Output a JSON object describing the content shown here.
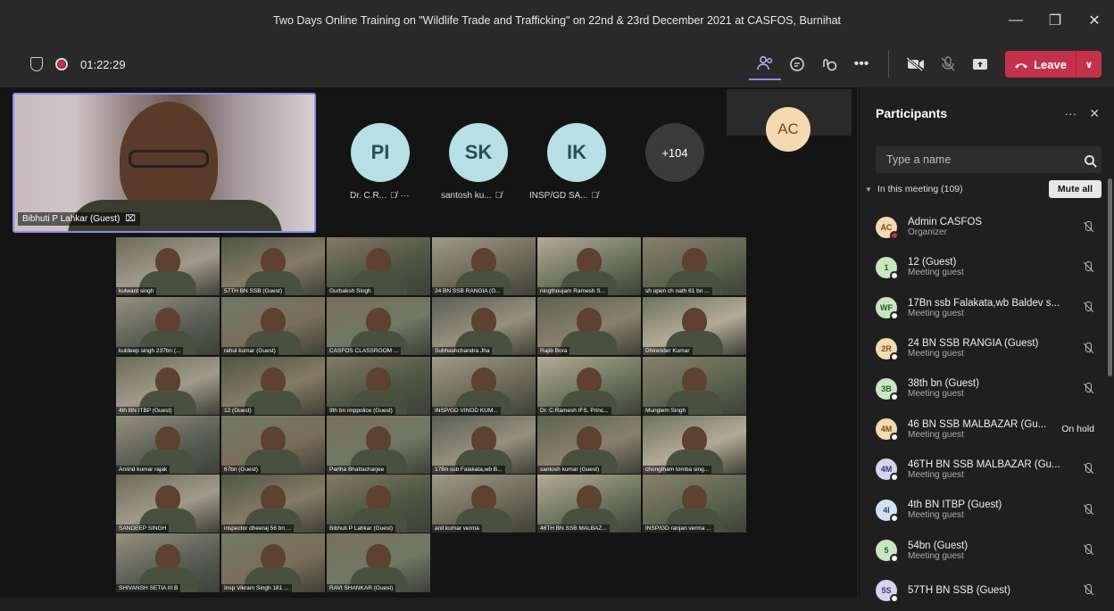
{
  "window": {
    "title": "Two Days Online Training on \"Wildlife Trade and Trafficking\" on 22nd & 23rd December 2021 at CASFOS, Burnihat",
    "controls": [
      "—",
      "❐",
      "✕"
    ]
  },
  "toolbar": {
    "timer": "01:22:29",
    "leave_label": "Leave",
    "icons": [
      "people-icon",
      "chat-icon",
      "react-icon",
      "more-icon",
      "camera-off-icon",
      "mic-off-icon",
      "share-icon"
    ]
  },
  "stage": {
    "self_name": "Bibhuti P Lahkar (Guest)",
    "avatars": [
      {
        "initials": "PI",
        "label": "Dr. C.R..."
      },
      {
        "initials": "SK",
        "label": "santosh ku..."
      },
      {
        "initials": "IK",
        "label": "INSP/GD SA..."
      },
      {
        "initials": "+104",
        "label": ""
      }
    ],
    "top_right_initials": "AC",
    "grid_captions": [
      "kulwant singh",
      "57TH BN SSB (Guest)",
      "Gurbaksh Singh",
      "24 BN SSB RANGIA (G...",
      "ningthoujam Ramesh S...",
      "sh upen ch nath 61 bn ...",
      "kuldeep singh 237bn (...",
      "rahul kumar (Guest)",
      "CASFOS CLASSROOM ...",
      "Subhashchandra Jha",
      "Rajib Bora",
      "Dhirender Kumar",
      "4th BN ITBP (Guest)",
      "12 (Guest)",
      "9th bn imppolice (Guest)",
      "INSP/GD VINOD KUM...",
      "Dr. C.Ramesh IFS, Princ...",
      "Munglem Singh",
      "Arvind kumar rajak",
      "67bn (Guest)",
      "Partha Bhattacharjee",
      "17Bn ssb Falakata,wb B...",
      "santosh kumar (Guest)",
      "chongtham tomba sing...",
      "SANDEEP SINGH",
      "inspector dheeraj 56 bn ...",
      "Bibhuti P Lahkar (Guest)",
      "anil kumar verma",
      "46TH BN SSB MALBAZ...",
      "INSP/GD ranjan verma ...",
      "SHIVANSH SETIA III B",
      "Insp Vikram Singh 181 ...",
      "RAVI SHANKAR (Guest)"
    ]
  },
  "panel": {
    "title": "Participants",
    "search_placeholder": "Type a name",
    "section_label": "In this meeting (109)",
    "mute_all_label": "Mute all",
    "participants": [
      {
        "initials": "AC",
        "name": "Admin CASFOS",
        "role": "Organizer",
        "color": "#f5d9b0",
        "fg": "#7a4a1a",
        "status": "",
        "dot": "red"
      },
      {
        "initials": "1",
        "name": "12 (Guest)",
        "role": "Meeting guest",
        "color": "#c8e6c0",
        "fg": "#2d5a2a",
        "status": "",
        "dot": "white"
      },
      {
        "initials": "WF",
        "name": "17Bn ssb Falakata,wb Baldev s...",
        "role": "Meeting guest",
        "color": "#c8e6c0",
        "fg": "#2d5a2a",
        "status": "",
        "dot": "white"
      },
      {
        "initials": "2R",
        "name": "24 BN SSB RANGIA (Guest)",
        "role": "Meeting guest",
        "color": "#f5d9b0",
        "fg": "#7a4a1a",
        "status": "",
        "dot": "white"
      },
      {
        "initials": "3B",
        "name": "38th bn (Guest)",
        "role": "Meeting guest",
        "color": "#c8e6c0",
        "fg": "#2d5a2a",
        "status": "",
        "dot": "white"
      },
      {
        "initials": "4M",
        "name": "46 BN SSB MALBAZAR (Gu...",
        "role": "Meeting guest",
        "color": "#f5d9b0",
        "fg": "#7a4a1a",
        "status": "On hold",
        "dot": "white"
      },
      {
        "initials": "4M",
        "name": "46TH BN SSB MALBAZAR (Gu...",
        "role": "Meeting guest",
        "color": "#d6d3f0",
        "fg": "#3d3a6a",
        "status": "",
        "dot": "white"
      },
      {
        "initials": "4I",
        "name": "4th BN ITBP (Guest)",
        "role": "Meeting guest",
        "color": "#cfe2f3",
        "fg": "#2a4a6a",
        "status": "",
        "dot": "white"
      },
      {
        "initials": "5",
        "name": "54bn (Guest)",
        "role": "Meeting guest",
        "color": "#c8e6c0",
        "fg": "#2d5a2a",
        "status": "",
        "dot": "white"
      },
      {
        "initials": "5S",
        "name": "57TH BN SSB (Guest)",
        "role": "",
        "color": "#d6d3f0",
        "fg": "#3d3a6a",
        "status": "",
        "dot": "white"
      }
    ]
  }
}
